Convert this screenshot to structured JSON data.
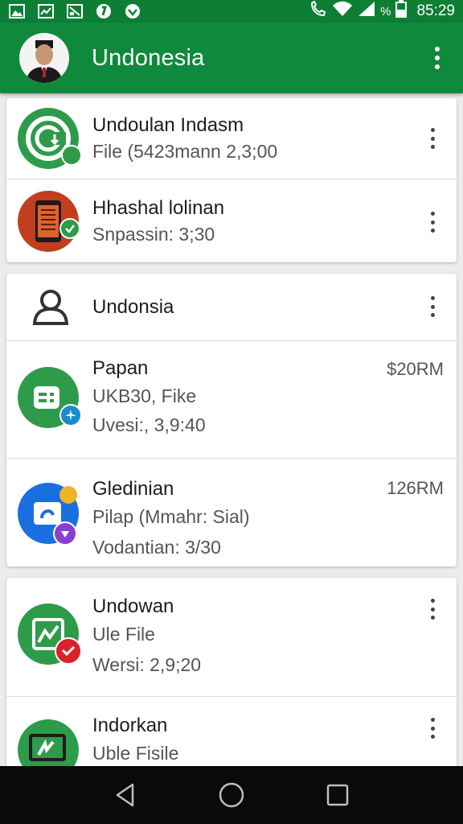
{
  "status_bar": {
    "time": "85:29",
    "battery_label": "%",
    "icons": [
      "image-icon",
      "chart-icon",
      "gallery-icon",
      "shield-icon",
      "badge-icon",
      "call-icon",
      "wifi-icon",
      "signal-icon",
      "battery-icon"
    ]
  },
  "app_bar": {
    "title": "Undonesia",
    "avatar": "avatar",
    "menu": "more-vert-icon"
  },
  "section1": {
    "rows": [
      {
        "title": "Undoulan Indasm",
        "subtitle": "File (5423mann 2,3;00",
        "icon": "download-icon",
        "badge": "check-badge"
      },
      {
        "title": "Hhashal lolinan",
        "subtitle": "Snpassin: 3;30",
        "icon": "phone-document-icon",
        "badge": "check-badge"
      }
    ]
  },
  "section2": {
    "header": {
      "title": "Undonsia",
      "icon": "user-icon"
    },
    "rows": [
      {
        "title": "Papan",
        "line2": "UKB30, Fike",
        "line3": "Uvesi:, 3,9:40",
        "time": "$20RM",
        "icon": "chat-icon",
        "badge": "airplane-badge"
      },
      {
        "title": "Gledinian",
        "line2": "Pilap (Mmahr: Sial)",
        "line3": "Vodantian: 3/30",
        "time": "126RM",
        "icon": "app-icon",
        "badge": "star-badge"
      }
    ]
  },
  "section3": {
    "rows": [
      {
        "title": "Undowan",
        "line2": "Ule File",
        "line3": "Wersi: 2,9;20",
        "icon": "chart-up-icon",
        "badge": "check-badge"
      },
      {
        "title": "Indorkan",
        "line2": "Uble Fisile",
        "icon": "monitor-icon"
      }
    ]
  },
  "colors": {
    "status_bar": "#0d7f34",
    "app_bar": "#0f8a3c",
    "green_icon": "#2e9b4a",
    "blue_icon": "#1a6fe0",
    "red_icon": "#c13f1e"
  },
  "nav": [
    "back-icon",
    "home-icon",
    "recents-icon"
  ]
}
